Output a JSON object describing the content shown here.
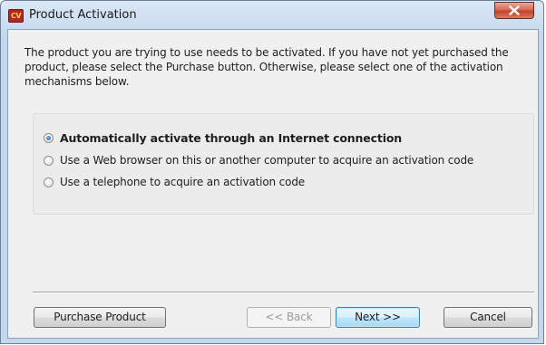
{
  "window": {
    "title": "Product Activation",
    "app_icon_text": "CV"
  },
  "intro_text": "The product you are trying to use needs to be activated. If you have not yet purchased the product, please select the Purchase button. Otherwise, please select one of the activation mechanisms below.",
  "options": [
    {
      "label": "Automatically activate through an Internet connection",
      "selected": true
    },
    {
      "label": "Use a Web browser on this or another computer to acquire an activation code",
      "selected": false
    },
    {
      "label": "Use a telephone to acquire an activation code",
      "selected": false
    }
  ],
  "buttons": {
    "purchase": "Purchase Product",
    "back": "<< Back",
    "next": "Next >>",
    "cancel": "Cancel"
  },
  "colors": {
    "close_button": "#c2432a",
    "default_button_border": "#3c7fb1",
    "client_background": "#f0f0f0"
  }
}
